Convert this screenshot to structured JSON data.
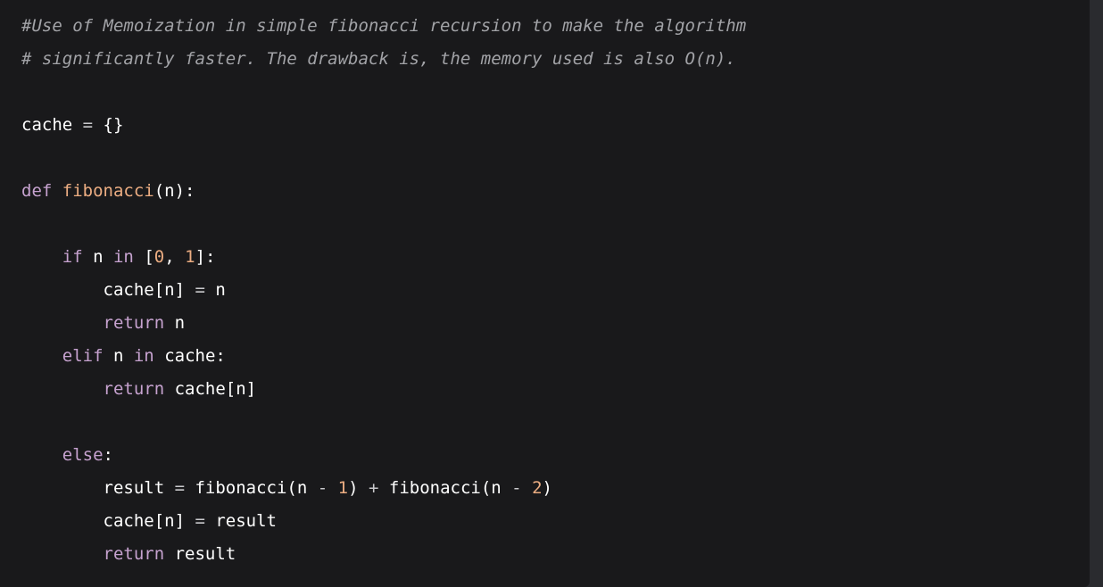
{
  "colors": {
    "background": "#19191b",
    "comment": "#a2a3a7",
    "keyword": "#c6a2cf",
    "function_name": "#ecad82",
    "number": "#ecad82",
    "plain_text": "#ffffff"
  },
  "code": {
    "language": "python",
    "lines": [
      {
        "tokens": [
          {
            "text": "#Use of Memoization in simple fibonacci recursion to make the algorithm",
            "type": "comment"
          }
        ]
      },
      {
        "tokens": [
          {
            "text": "# significantly faster. The drawback is, the memory used is also O(n).",
            "type": "comment"
          }
        ]
      },
      {
        "tokens": []
      },
      {
        "tokens": [
          {
            "text": "cache",
            "type": "plain"
          },
          {
            "text": " = ",
            "type": "op"
          },
          {
            "text": "{}",
            "type": "punct"
          }
        ]
      },
      {
        "tokens": []
      },
      {
        "tokens": [
          {
            "text": "def",
            "type": "keyword"
          },
          {
            "text": " ",
            "type": "plain"
          },
          {
            "text": "fibonacci",
            "type": "func"
          },
          {
            "text": "(n):",
            "type": "punct"
          }
        ]
      },
      {
        "tokens": []
      },
      {
        "tokens": [
          {
            "text": "    ",
            "type": "plain"
          },
          {
            "text": "if",
            "type": "keyword"
          },
          {
            "text": " n ",
            "type": "plain"
          },
          {
            "text": "in",
            "type": "keyword"
          },
          {
            "text": " [",
            "type": "punct"
          },
          {
            "text": "0",
            "type": "number"
          },
          {
            "text": ", ",
            "type": "punct"
          },
          {
            "text": "1",
            "type": "number"
          },
          {
            "text": "]:",
            "type": "punct"
          }
        ]
      },
      {
        "tokens": [
          {
            "text": "        cache[n]",
            "type": "plain"
          },
          {
            "text": " = ",
            "type": "op"
          },
          {
            "text": "n",
            "type": "plain"
          }
        ]
      },
      {
        "tokens": [
          {
            "text": "        ",
            "type": "plain"
          },
          {
            "text": "return",
            "type": "keyword"
          },
          {
            "text": " n",
            "type": "plain"
          }
        ]
      },
      {
        "tokens": [
          {
            "text": "    ",
            "type": "plain"
          },
          {
            "text": "elif",
            "type": "keyword"
          },
          {
            "text": " n ",
            "type": "plain"
          },
          {
            "text": "in",
            "type": "keyword"
          },
          {
            "text": " cache:",
            "type": "plain"
          }
        ]
      },
      {
        "tokens": [
          {
            "text": "        ",
            "type": "plain"
          },
          {
            "text": "return",
            "type": "keyword"
          },
          {
            "text": " cache[n]",
            "type": "plain"
          }
        ]
      },
      {
        "tokens": []
      },
      {
        "tokens": [
          {
            "text": "    ",
            "type": "plain"
          },
          {
            "text": "else",
            "type": "keyword"
          },
          {
            "text": ":",
            "type": "punct"
          }
        ]
      },
      {
        "tokens": [
          {
            "text": "        result",
            "type": "plain"
          },
          {
            "text": " = ",
            "type": "op"
          },
          {
            "text": "fibonacci(n",
            "type": "plain"
          },
          {
            "text": " - ",
            "type": "op"
          },
          {
            "text": "1",
            "type": "number"
          },
          {
            "text": ")",
            "type": "punct"
          },
          {
            "text": " + ",
            "type": "op"
          },
          {
            "text": "fibonacci(n",
            "type": "plain"
          },
          {
            "text": " - ",
            "type": "op"
          },
          {
            "text": "2",
            "type": "number"
          },
          {
            "text": ")",
            "type": "punct"
          }
        ]
      },
      {
        "tokens": [
          {
            "text": "        cache[n]",
            "type": "plain"
          },
          {
            "text": " = ",
            "type": "op"
          },
          {
            "text": "result",
            "type": "plain"
          }
        ]
      },
      {
        "tokens": [
          {
            "text": "        ",
            "type": "plain"
          },
          {
            "text": "return",
            "type": "keyword"
          },
          {
            "text": " result",
            "type": "plain"
          }
        ]
      }
    ]
  }
}
